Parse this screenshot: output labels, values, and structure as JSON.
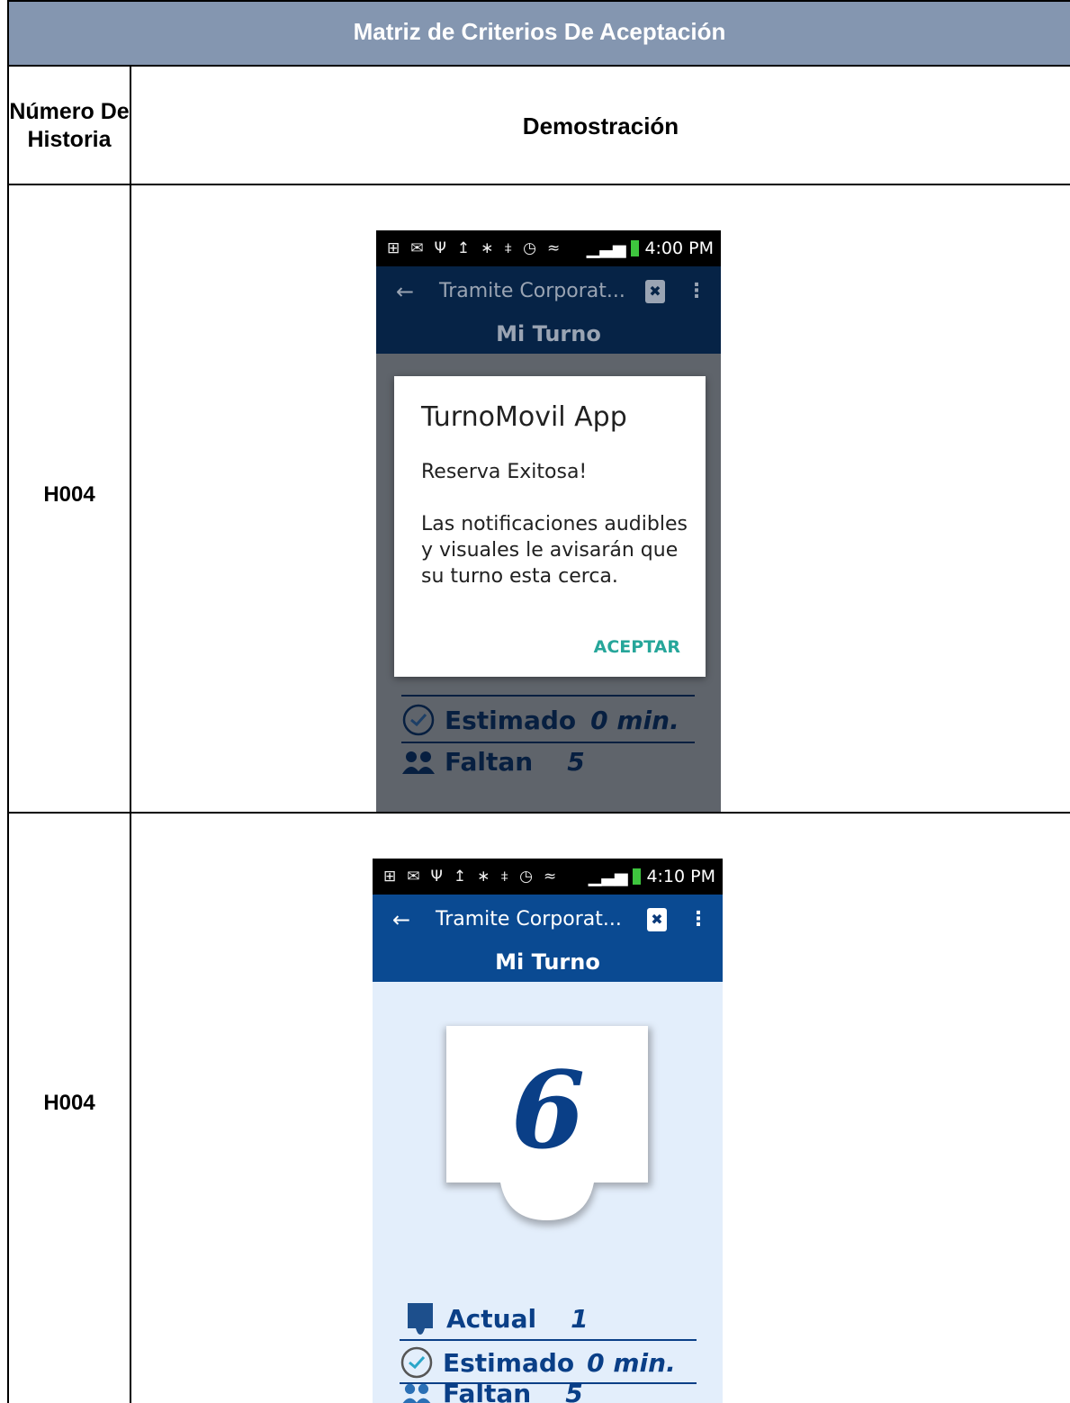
{
  "document": {
    "title": "Matriz de Criterios De Aceptación",
    "header_number": "Número De Historia",
    "header_demo": "Demostración",
    "rows": [
      {
        "story": "H004",
        "screen": {
          "status_time": "4:00 PM",
          "appbar_title": "Tramite Corporat...",
          "subtitle": "Mi Turno",
          "dialog": {
            "title": "TurnoMovil App",
            "message": "Reserva Exitosa!\n\nLas notificaciones audibles y visuales le avisarán que su turno esta cerca.",
            "button": "ACEPTAR"
          },
          "stats": [
            {
              "label": "Estimado",
              "value": "0 min.",
              "icon": "clock-24-icon"
            },
            {
              "label": "Faltan",
              "value": "5",
              "icon": "people-icon"
            }
          ]
        }
      },
      {
        "story": "H004",
        "screen": {
          "status_time": "4:10 PM",
          "appbar_title": "Tramite Corporat...",
          "subtitle": "Mi Turno",
          "ticket_number": "6",
          "stats": [
            {
              "label": "Actual",
              "value": "1",
              "icon": "ticket-icon"
            },
            {
              "label": "Estimado",
              "value": "0 min.",
              "icon": "clock-24-icon"
            },
            {
              "label": "Faltan",
              "value": "5",
              "icon": "people-icon"
            }
          ]
        }
      }
    ]
  },
  "colors": {
    "title_bg": "#8496b0",
    "appbar_blue": "#0a4a92",
    "appbar_dim": "#062346",
    "content_light": "#e3eefb",
    "content_dim": "#5f646b",
    "accent_teal": "#26a69a"
  }
}
